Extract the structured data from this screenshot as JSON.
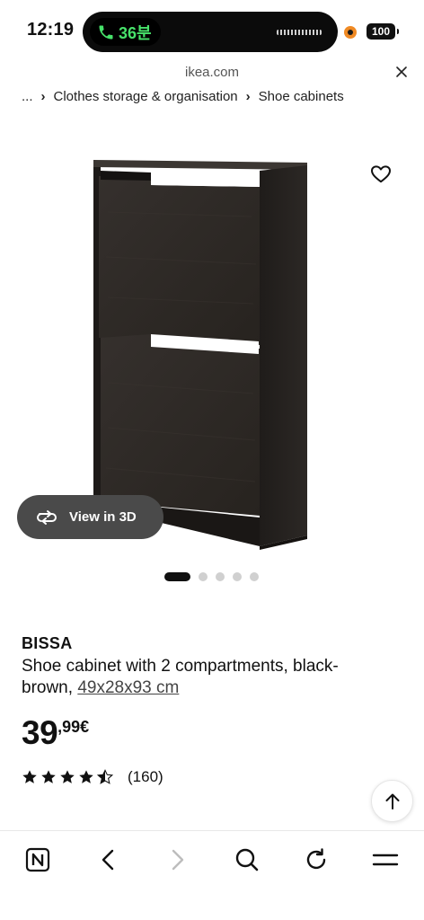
{
  "status_bar": {
    "time": "12:19",
    "call_label": "36분",
    "battery": "100"
  },
  "browser": {
    "url": "ikea.com"
  },
  "breadcrumb": {
    "ellipsis": "...",
    "items": [
      "Clothes storage & organisation",
      "Shoe cabinets"
    ]
  },
  "gallery": {
    "view_3d_label": "View in 3D",
    "image_count": 5,
    "active_index": 0
  },
  "product": {
    "name": "BISSA",
    "description": "Shoe cabinet with 2 compartments, black-brown, ",
    "dimensions": "49x28x93 cm",
    "price_integer": "39",
    "price_decimal": ",99€",
    "rating": 4.5,
    "review_count": "(160)"
  },
  "toolbar": {
    "icons": [
      "n-logo-icon",
      "back-icon",
      "forward-icon",
      "search-icon",
      "reload-icon",
      "menu-icon"
    ]
  },
  "colors": {
    "cabinet": "#2b2725",
    "call_green": "#47e26a",
    "recording": "#f08a24"
  }
}
